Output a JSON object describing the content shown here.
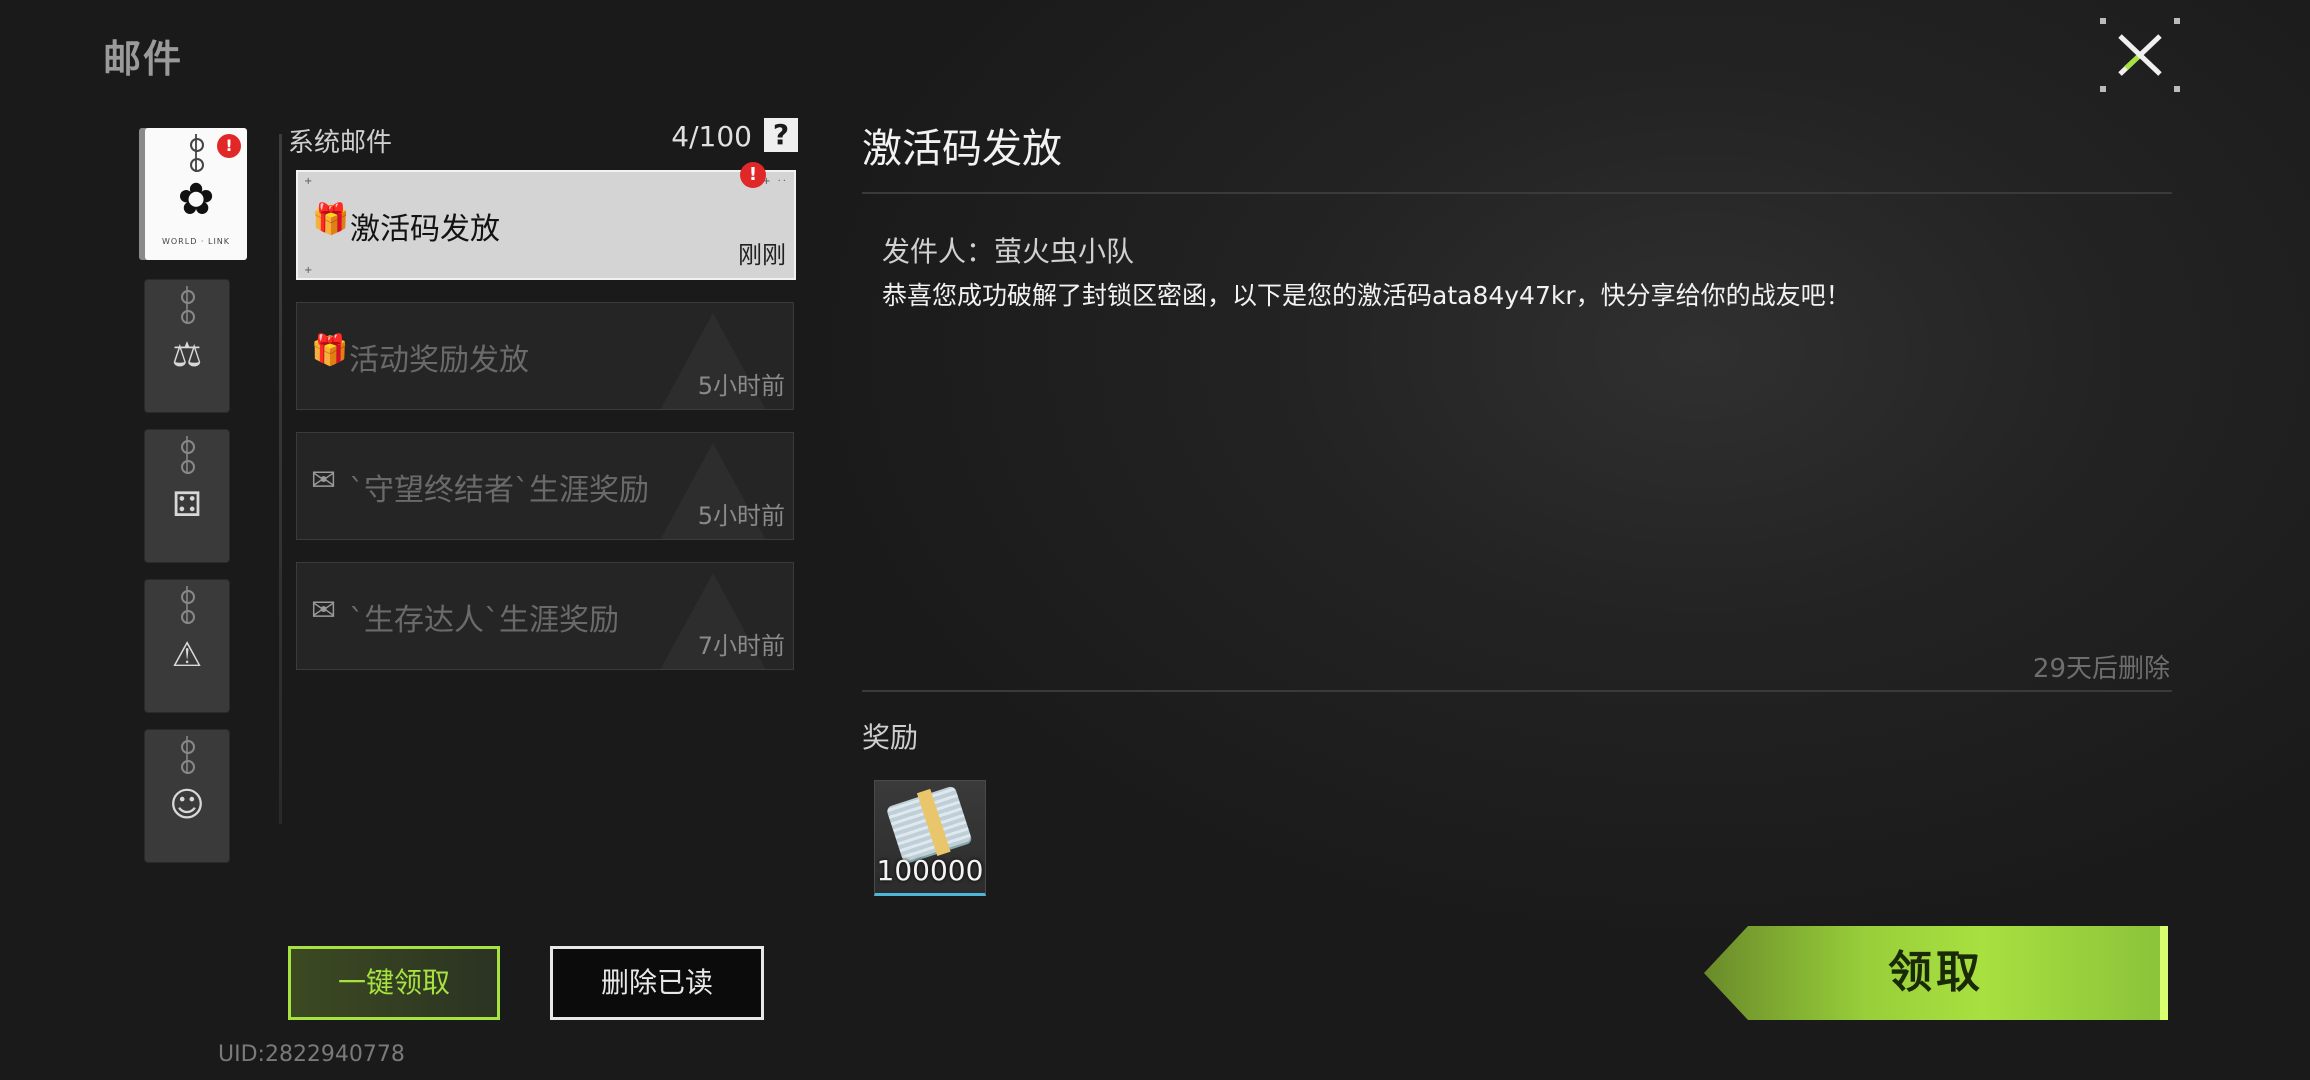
{
  "header": {
    "title": "邮件",
    "close_label": "close"
  },
  "categories": [
    {
      "glyph": "✿",
      "caption": "WORLD · LINK",
      "active": true,
      "alert": "!"
    },
    {
      "glyph": "⚖",
      "caption": "",
      "active": false
    },
    {
      "glyph": "⚃",
      "caption": "",
      "active": false
    },
    {
      "glyph": "⚠",
      "caption": "",
      "active": false
    },
    {
      "glyph": "☺",
      "caption": "",
      "active": false
    }
  ],
  "mail_list": {
    "title": "系统邮件",
    "count": "4/100",
    "help": "?",
    "alert": "!",
    "items": [
      {
        "icon": "gift-icon",
        "glyph": "🎁",
        "subject": "激活码发放",
        "time": "刚刚",
        "active": true
      },
      {
        "icon": "gift-box-icon",
        "glyph": "🎁",
        "subject": "活动奖励发放",
        "time": "5小时前",
        "active": false
      },
      {
        "icon": "envelope-icon",
        "glyph": "✉",
        "subject": "`守望终结者`生涯奖励",
        "time": "5小时前",
        "active": false
      },
      {
        "icon": "envelope-icon",
        "glyph": "✉",
        "subject": "`生存达人`生涯奖励",
        "time": "7小时前",
        "active": false
      }
    ]
  },
  "buttons": {
    "claim_all": "一键领取",
    "delete_read": "删除已读",
    "claim": "领取"
  },
  "uid": "UID:2822940778",
  "detail": {
    "title": "激活码发放",
    "sender_label": "发件人：",
    "sender": "萤火虫小队",
    "body": "恭喜您成功破解了封锁区密函，以下是您的激活码ata84y47kr，快分享给你的战友吧！",
    "expire": "29天后删除",
    "rewards_label": "奖励",
    "rewards": [
      {
        "icon": "cash-bundle-icon",
        "quantity": "100000"
      }
    ]
  },
  "colors": {
    "accent": "#a6e340",
    "alert": "#e02828",
    "reward_border": "#4cb7d8"
  }
}
